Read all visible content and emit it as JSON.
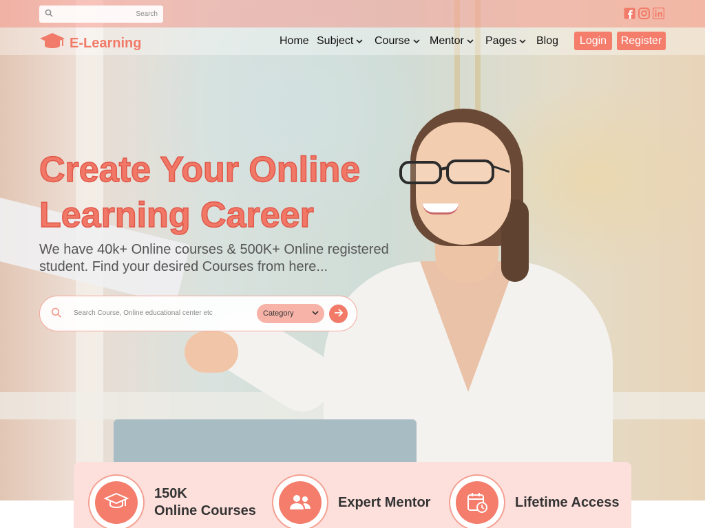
{
  "topbar": {
    "search_placeholder": "Search",
    "socials": [
      {
        "icon": "facebook-icon"
      },
      {
        "icon": "instagram-icon"
      },
      {
        "icon": "linkedin-icon"
      }
    ]
  },
  "brand": {
    "name": "E-Learning",
    "accent": "#f27a68"
  },
  "nav": {
    "items": [
      {
        "label": "Home",
        "dropdown": false
      },
      {
        "label": "Subject",
        "dropdown": true
      },
      {
        "label": "Course",
        "dropdown": true
      },
      {
        "label": "Mentor",
        "dropdown": true
      },
      {
        "label": "Pages",
        "dropdown": true
      },
      {
        "label": "Blog",
        "dropdown": false
      }
    ],
    "login_label": "Login",
    "register_label": "Register"
  },
  "hero": {
    "headline_line1": "Create Your Online",
    "headline_line2": "Learning Career",
    "subtitle": "We have 40k+ Online courses & 500K+ Online registered student. Find your desired Courses from here...",
    "search_placeholder": "Search Course, Online educational center etc",
    "category_label": "Category"
  },
  "stats": [
    {
      "line1": "150K",
      "line2": "Online Courses",
      "icon": "graduation-cap-icon"
    },
    {
      "line1": "Expert Mentor",
      "line2": "",
      "icon": "users-icon"
    },
    {
      "line1": "Lifetime Access",
      "line2": "",
      "icon": "calendar-clock-icon"
    }
  ]
}
